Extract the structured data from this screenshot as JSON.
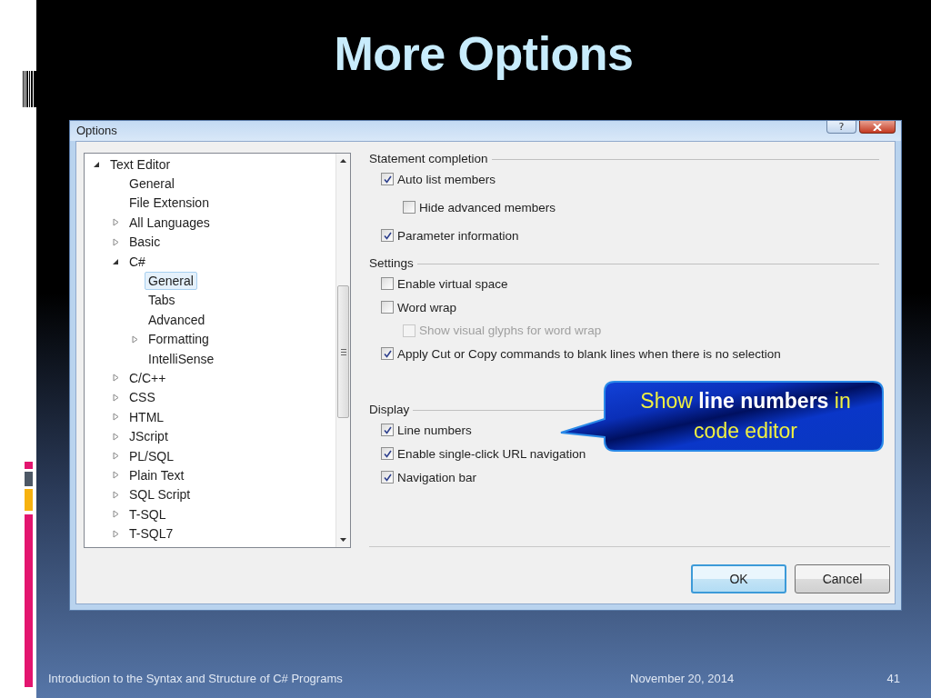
{
  "slide": {
    "title": "More Options"
  },
  "dialog": {
    "title": "Options",
    "help_button": "?",
    "tree": [
      {
        "label": "Text Editor",
        "kind": "node",
        "expanded": true,
        "selected": false,
        "children": [
          {
            "label": "General",
            "kind": "leaf",
            "selected": false
          },
          {
            "label": "File Extension",
            "kind": "leaf",
            "selected": false
          },
          {
            "label": "All Languages",
            "kind": "node",
            "expanded": false,
            "selected": false
          },
          {
            "label": "Basic",
            "kind": "node",
            "expanded": false,
            "selected": false
          },
          {
            "label": "C#",
            "kind": "node",
            "expanded": true,
            "selected": false,
            "children": [
              {
                "label": "General",
                "kind": "leaf",
                "selected": true
              },
              {
                "label": "Tabs",
                "kind": "leaf",
                "selected": false
              },
              {
                "label": "Advanced",
                "kind": "leaf",
                "selected": false
              },
              {
                "label": "Formatting",
                "kind": "node",
                "expanded": false,
                "selected": false
              },
              {
                "label": "IntelliSense",
                "kind": "leaf",
                "selected": false
              }
            ]
          },
          {
            "label": "C/C++",
            "kind": "node",
            "expanded": false,
            "selected": false
          },
          {
            "label": "CSS",
            "kind": "node",
            "expanded": false,
            "selected": false
          },
          {
            "label": "HTML",
            "kind": "node",
            "expanded": false,
            "selected": false
          },
          {
            "label": "JScript",
            "kind": "node",
            "expanded": false,
            "selected": false
          },
          {
            "label": "PL/SQL",
            "kind": "node",
            "expanded": false,
            "selected": false
          },
          {
            "label": "Plain Text",
            "kind": "node",
            "expanded": false,
            "selected": false
          },
          {
            "label": "SQL Script",
            "kind": "node",
            "expanded": false,
            "selected": false
          },
          {
            "label": "T-SQL",
            "kind": "node",
            "expanded": false,
            "selected": false
          },
          {
            "label": "T-SQL7",
            "kind": "node",
            "expanded": false,
            "selected": false
          }
        ]
      }
    ],
    "sections": [
      {
        "heading": "Statement completion",
        "options": [
          {
            "label": "Auto list members",
            "checked": true,
            "disabled": false,
            "children": [
              {
                "label": "Hide advanced members",
                "checked": false,
                "disabled": false
              }
            ]
          },
          {
            "label": "Parameter information",
            "checked": true,
            "disabled": false
          }
        ]
      },
      {
        "heading": "Settings",
        "options": [
          {
            "label": "Enable virtual space",
            "checked": false,
            "disabled": false
          },
          {
            "label": "Word wrap",
            "checked": false,
            "disabled": false,
            "children": [
              {
                "label": "Show visual glyphs for word wrap",
                "checked": false,
                "disabled": true
              }
            ]
          },
          {
            "label": "Apply Cut or Copy commands to blank lines when there is no selection",
            "checked": true,
            "disabled": false
          }
        ]
      },
      {
        "heading": "Display",
        "options": [
          {
            "label": "Line numbers",
            "checked": true,
            "disabled": false
          },
          {
            "label": "Enable single-click URL navigation",
            "checked": true,
            "disabled": false
          },
          {
            "label": "Navigation bar",
            "checked": true,
            "disabled": false
          }
        ]
      }
    ],
    "buttons": [
      {
        "label": "OK",
        "default": true
      },
      {
        "label": "Cancel",
        "default": false
      }
    ]
  },
  "callout": {
    "text": "Show **line numbers** in code editor"
  },
  "footer": {
    "text": "Introduction to the Syntax and Structure of C# Programs",
    "date": "November 20, 2014",
    "page": "41"
  }
}
